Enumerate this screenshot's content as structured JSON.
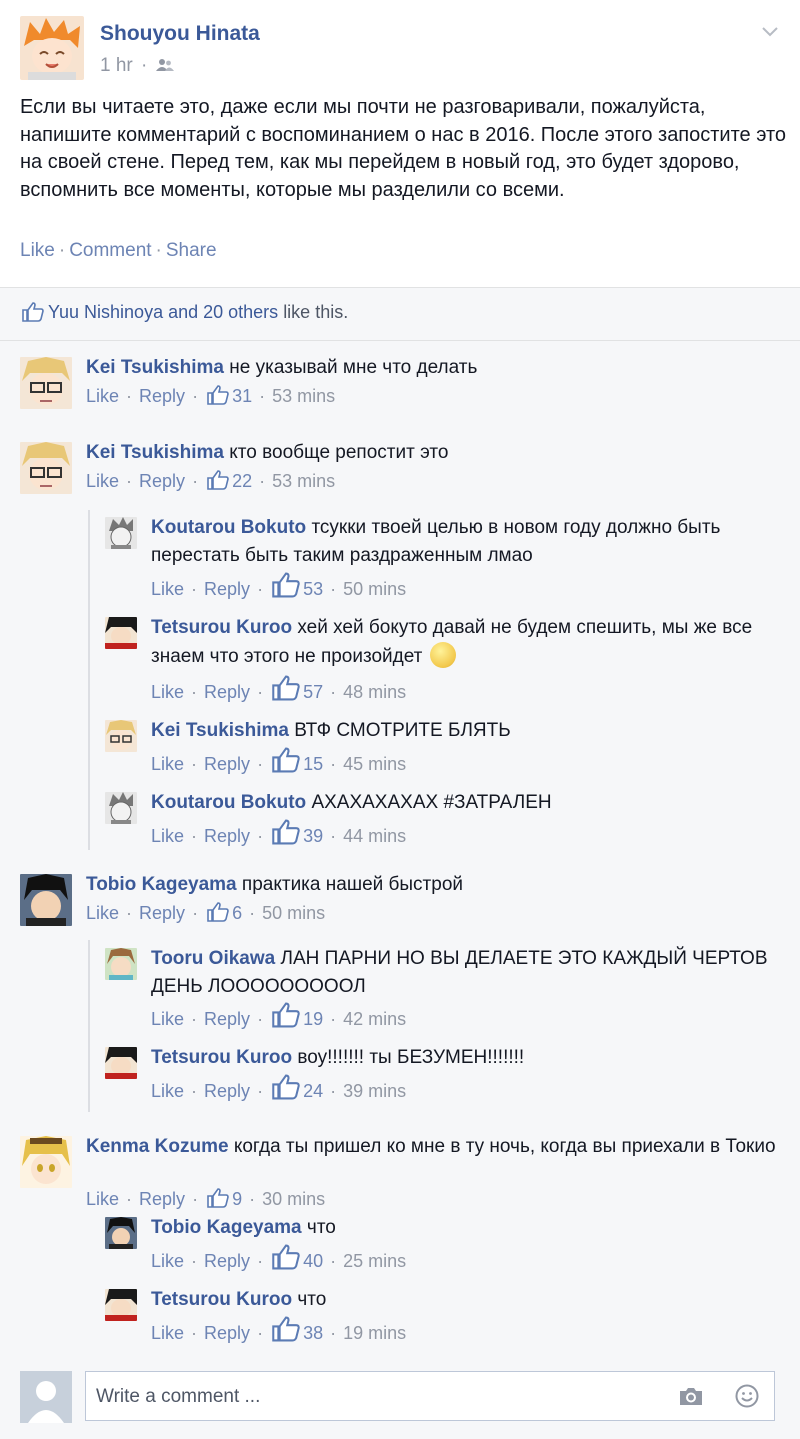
{
  "post": {
    "author": "Shouyou Hinata",
    "time": "1 hr",
    "text": "Если вы читаете это, даже если мы почти не разговаривали, пожалуйста, напишите комментарий с воспоминанием о нас в 2016. После этого запостите это на своей стене. Перед тем, как мы перейдем в новый год, это будет здорово, вспомнить все моменты, которые мы разделили со всеми.",
    "actions": [
      "Like",
      "Comment",
      "Share"
    ]
  },
  "likes": {
    "names": "Yuu Nishinoya and 20 others",
    "suffix": "like this."
  },
  "labels": {
    "like": "Like",
    "reply": "Reply"
  },
  "comments": [
    {
      "name": "Kei Tsukishima",
      "text": "не указывай мне что делать",
      "likes": "31",
      "time": "53 mins"
    },
    {
      "name": "Kei Tsukishima",
      "text": "кто вообще репостит это",
      "likes": "22",
      "time": "53 mins"
    },
    {
      "name": "Koutarou Bokuto",
      "text": "тсукки твоей целью в новом году должно быть перестать быть таким раздраженным лмао",
      "likes": "53",
      "time": "50 mins"
    },
    {
      "name": "Tetsurou Kuroo",
      "text": "хей хей бокуто давай не будем спешить, мы же все знаем что этого не произойдет",
      "likes": "57",
      "time": "48 mins"
    },
    {
      "name": "Kei Tsukishima",
      "text": "ВТФ СМОТРИТЕ БЛЯТЬ",
      "likes": "15",
      "time": "45 mins"
    },
    {
      "name": "Koutarou Bokuto",
      "text": "АХАХАХАХАХ #ЗАТРАЛЕН",
      "likes": "39",
      "time": "44 mins"
    },
    {
      "name": "Tobio Kageyama",
      "text": "практика нашей быстрой",
      "likes": "6",
      "time": "50 mins"
    },
    {
      "name": "Tooru Oikawa",
      "text": "ЛАН ПАРНИ НО ВЫ ДЕЛАЕТЕ ЭТО КАЖДЫЙ ЧЕРТОВ ДЕНЬ ЛОООООООООЛ",
      "likes": "19",
      "time": "42 mins"
    },
    {
      "name": "Tetsurou Kuroo",
      "text": "воу!!!!!!! ты БЕЗУМЕН!!!!!!!",
      "likes": "24",
      "time": "39 mins"
    },
    {
      "name": "Kenma Kozume",
      "text": "когда ты пришел ко мне в ту ночь, когда вы приехали в Токио",
      "likes": "9",
      "time": "30 mins"
    },
    {
      "name": "Tobio Kageyama",
      "text": "что",
      "likes": "40",
      "time": "25 mins"
    },
    {
      "name": "Tetsurou Kuroo",
      "text": "что",
      "likes": "38",
      "time": "19 mins"
    }
  ],
  "compose": {
    "placeholder": "Write a comment ..."
  },
  "colors": {
    "link": "#3b5998",
    "meta": "#9197a3",
    "panel": "#f6f7f9"
  }
}
